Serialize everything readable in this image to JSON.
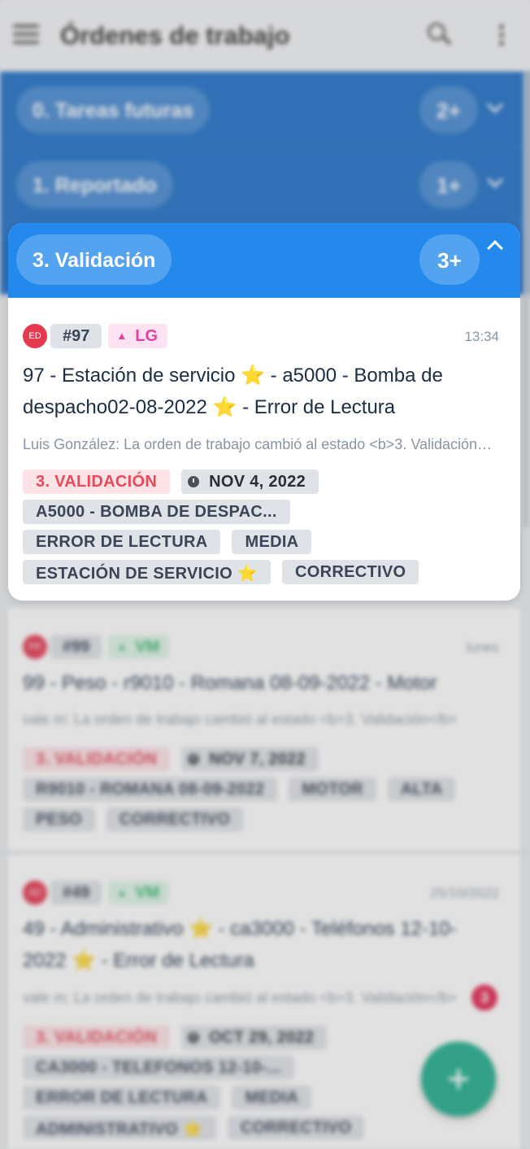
{
  "app_bar": {
    "title": "Órdenes de trabajo",
    "menu_icon": "menu-icon",
    "search_icon": "search-icon",
    "more_icon": "more-vert-icon"
  },
  "groups": [
    {
      "label": "0. Tareas futuras",
      "count": "2+",
      "expanded": false
    },
    {
      "label": "1. Reportado",
      "count": "1+",
      "expanded": false
    },
    {
      "label": "3. Validación",
      "count": "3+",
      "expanded": true
    }
  ],
  "orders": [
    {
      "avatar": "ED",
      "id": "#97",
      "user": "LG",
      "user_color": "#e63da0",
      "user_bg": "#fde3f1",
      "time": "13:34",
      "title_line1": "97 - Estación de servicio ⭐ - a5000 - Bomba de",
      "title_line2": "despacho02-08-2022 ⭐ - Error de Lectura",
      "snippet": "Luis González: La orden de trabajo cambió al estado <b>3. Validación</b>",
      "status": "3. VALIDACIÓN",
      "date": "NOV 4, 2022",
      "tags": [
        [
          "A5000 - BOMBA DE DESPAC..."
        ],
        [
          "ERROR DE LECTURA",
          "MEDIA"
        ],
        [
          "ESTACIÓN DE SERVICIO ⭐",
          "CORRECTIVO"
        ]
      ]
    },
    {
      "avatar": "PR",
      "id": "#99",
      "user": "VM",
      "user_color": "#35b66b",
      "user_bg": "#dff5e8",
      "time": "lunes",
      "title_line1": "99 - Peso - r9010 - Romana 08-09-2022 - Motor",
      "title_line2": "",
      "snippet": "vale m: La orden de trabajo cambió al estado <b>3. Validación</b>",
      "status": "3. VALIDACIÓN",
      "date": "NOV 7, 2022",
      "tags": [
        [
          "R9010 - ROMANA 08-09-2022",
          "MOTOR",
          "ALTA"
        ],
        [
          "PESO",
          "CORRECTIVO"
        ]
      ]
    },
    {
      "avatar": "AD",
      "id": "#49",
      "user": "VM",
      "user_color": "#35b66b",
      "user_bg": "#dff5e8",
      "time": "25/10/2022",
      "title_line1": "49 - Administrativo ⭐ - ca3000 - Teléfonos 12-10-",
      "title_line2": "2022 ⭐ - Error de Lectura",
      "snippet": "vale m: La orden de trabajo cambió al estado <b>3. Validación</b>",
      "badge": "3",
      "status": "3. VALIDACIÓN",
      "date": "OCT 29, 2022",
      "tags": [
        [
          "CA3000 - TELEFONOS 12-10-..."
        ],
        [
          "ERROR DE LECTURA",
          "MEDIA"
        ],
        [
          "ADMINISTRATIVO ⭐",
          "CORRECTIVO"
        ]
      ]
    }
  ],
  "fab": {
    "icon": "plus-icon"
  }
}
